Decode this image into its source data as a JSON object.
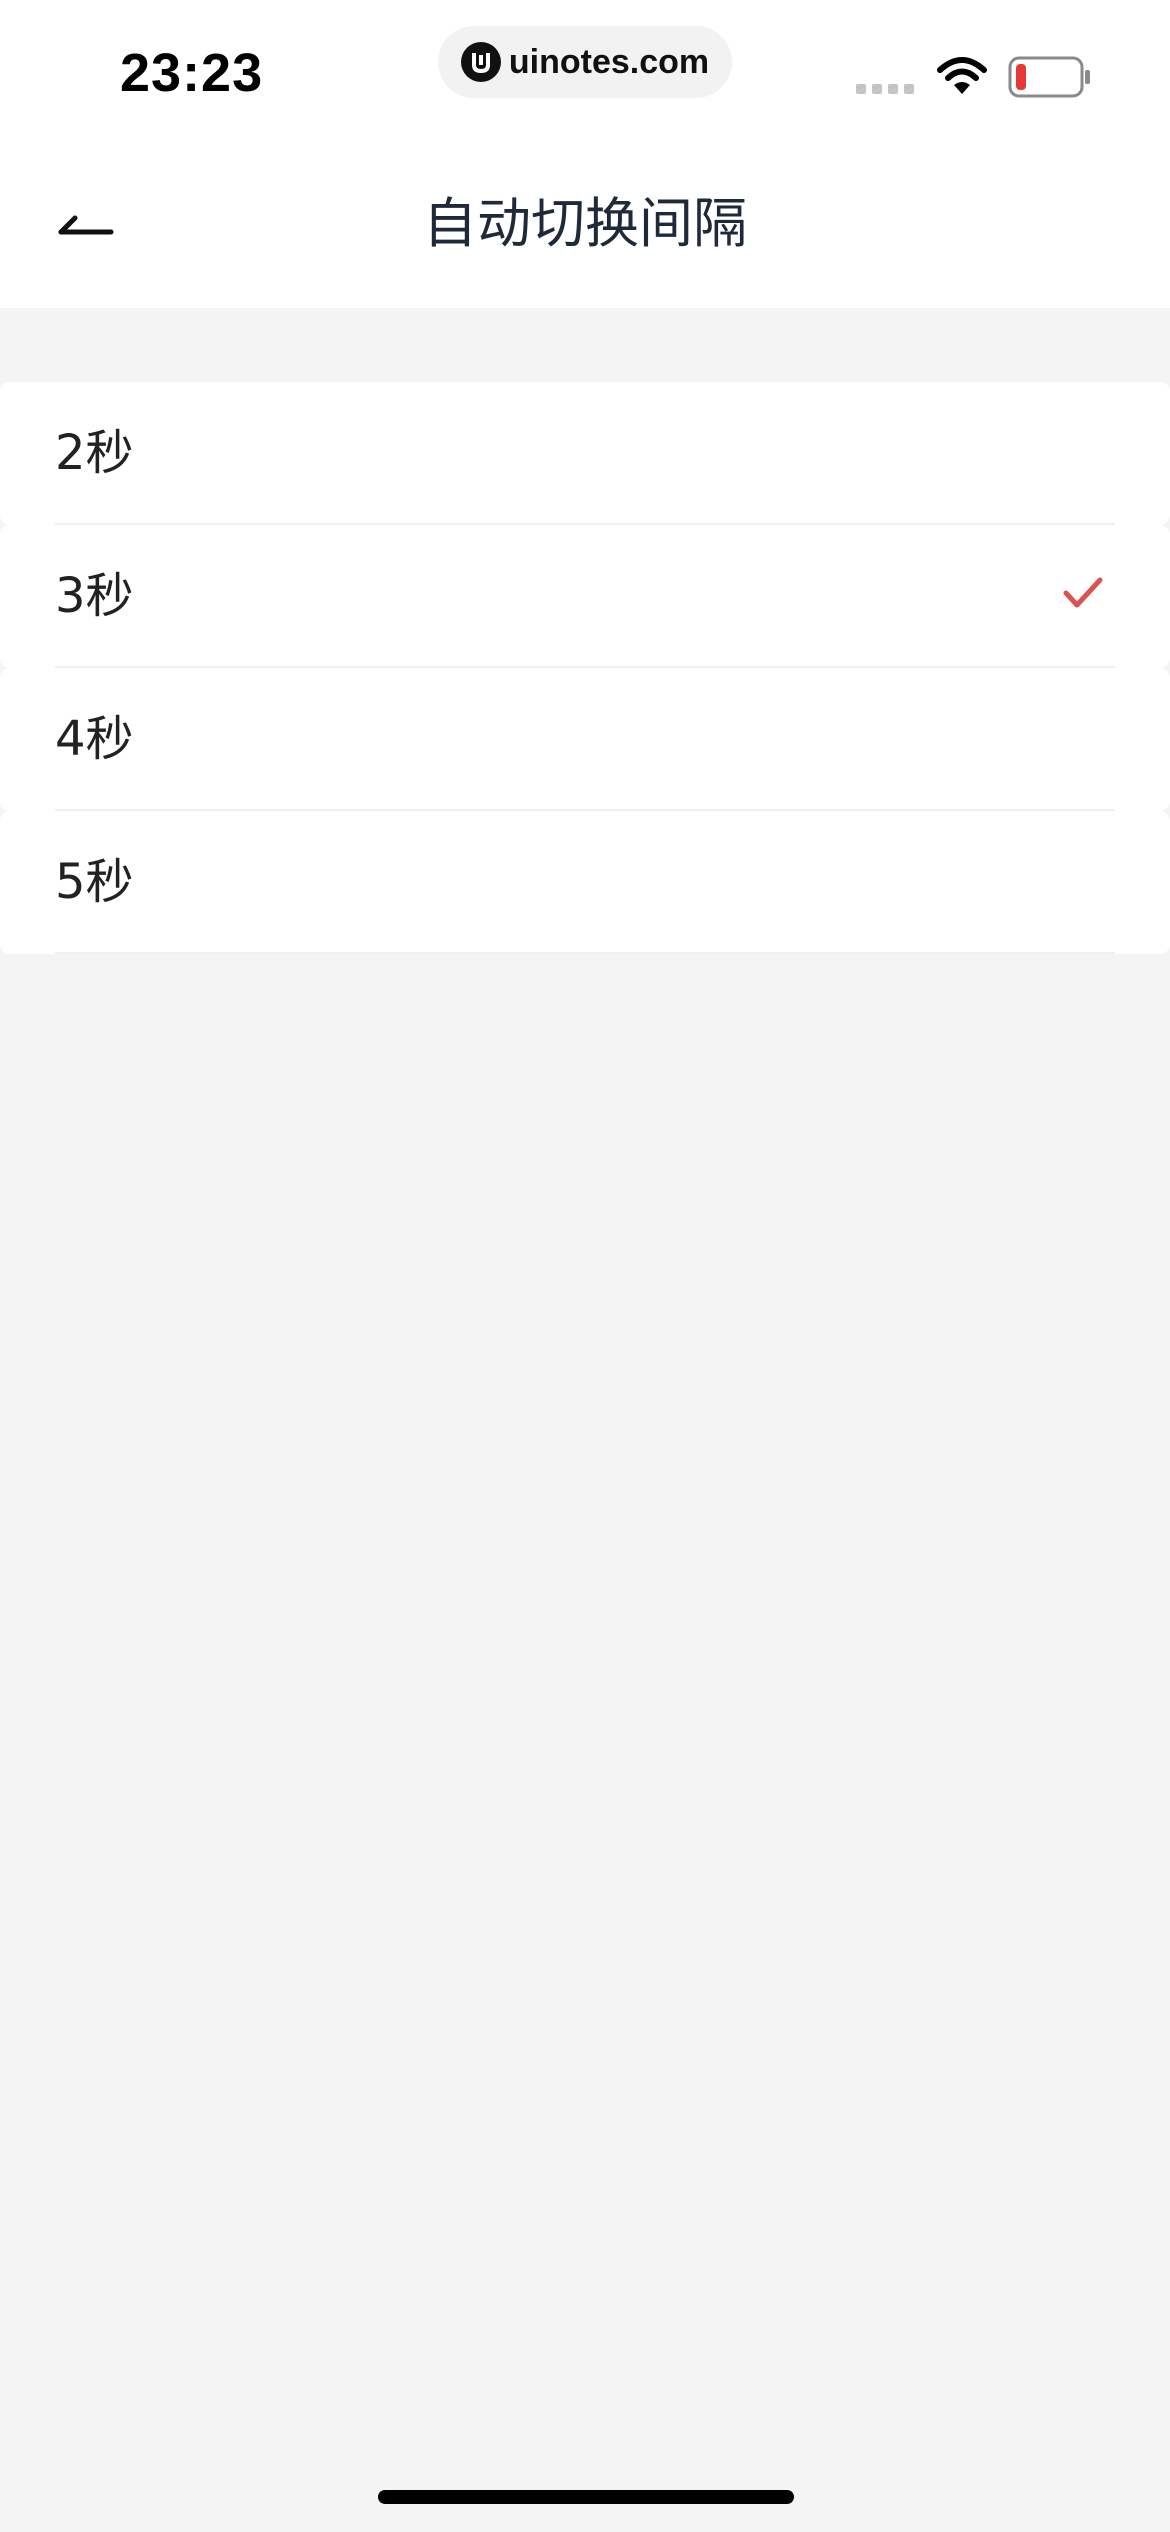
{
  "status_bar": {
    "time": "23:23",
    "url": "uinotes.com",
    "battery_color": "#e53935"
  },
  "nav": {
    "title": "自动切换间隔",
    "back_icon": "back-arrow-icon"
  },
  "options": [
    {
      "label": "2秒",
      "selected": false
    },
    {
      "label": "3秒",
      "selected": true
    },
    {
      "label": "4秒",
      "selected": false
    },
    {
      "label": "5秒",
      "selected": false
    }
  ],
  "colors": {
    "accent": "#d9534f",
    "background": "#f4f4f4",
    "title": "#1e2a3a"
  }
}
